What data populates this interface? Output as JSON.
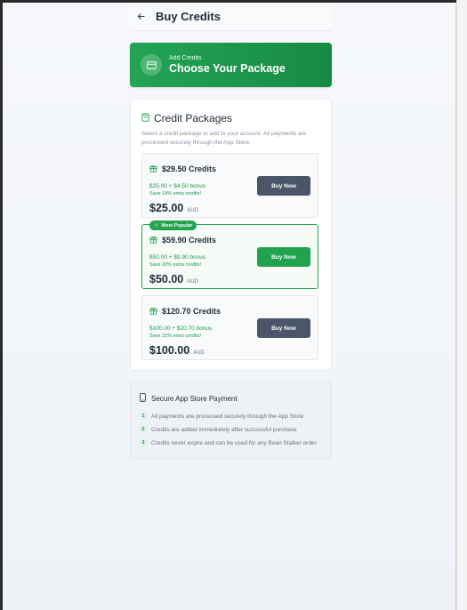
{
  "header": {
    "title": "Buy Credits"
  },
  "hero": {
    "subtitle": "Add Credits",
    "title": "Choose Your Package"
  },
  "packages_section": {
    "title": "Credit Packages",
    "description": "Select a credit package to add to your account. All payments are processed securely through the App Store."
  },
  "packages": [
    {
      "name": "$29.50 Credits",
      "bonus": "$25.00 + $4.50 bonus",
      "save": "Save 18% extra credits!",
      "price": "$25.00",
      "currency": "AUD",
      "button": "Buy Now",
      "popular": false
    },
    {
      "name": "$59.90 Credits",
      "bonus": "$50.00 + $9.90 bonus",
      "save": "Save 20% extra credits!",
      "price": "$50.00",
      "currency": "AUD",
      "button": "Buy Now",
      "popular": true,
      "badge": "Most Popular"
    },
    {
      "name": "$120.70 Credits",
      "bonus": "$100.00 + $20.70 bonus",
      "save": "Save 21% extra credits!",
      "price": "$100.00",
      "currency": "AUD",
      "button": "Buy Now",
      "popular": false
    }
  ],
  "secure": {
    "title": "Secure App Store Payment",
    "items": [
      {
        "num": "1",
        "text": "All payments are processed securely through the App Store"
      },
      {
        "num": "2",
        "text": "Credits are added immediately after successful purchase"
      },
      {
        "num": "3",
        "text": "Credits never expire and can be used for any Bean Stalker order"
      }
    ]
  },
  "icons": {
    "back": "arrow-left-icon",
    "hero": "credit-card-icon",
    "section": "shopping-bag-icon",
    "package": "gift-icon",
    "badge": "star-icon",
    "secure": "smartphone-icon"
  },
  "colors": {
    "accent": "#22a350",
    "dark_button": "#4a5567",
    "hero_start": "#23a455",
    "hero_end": "#178a44"
  }
}
